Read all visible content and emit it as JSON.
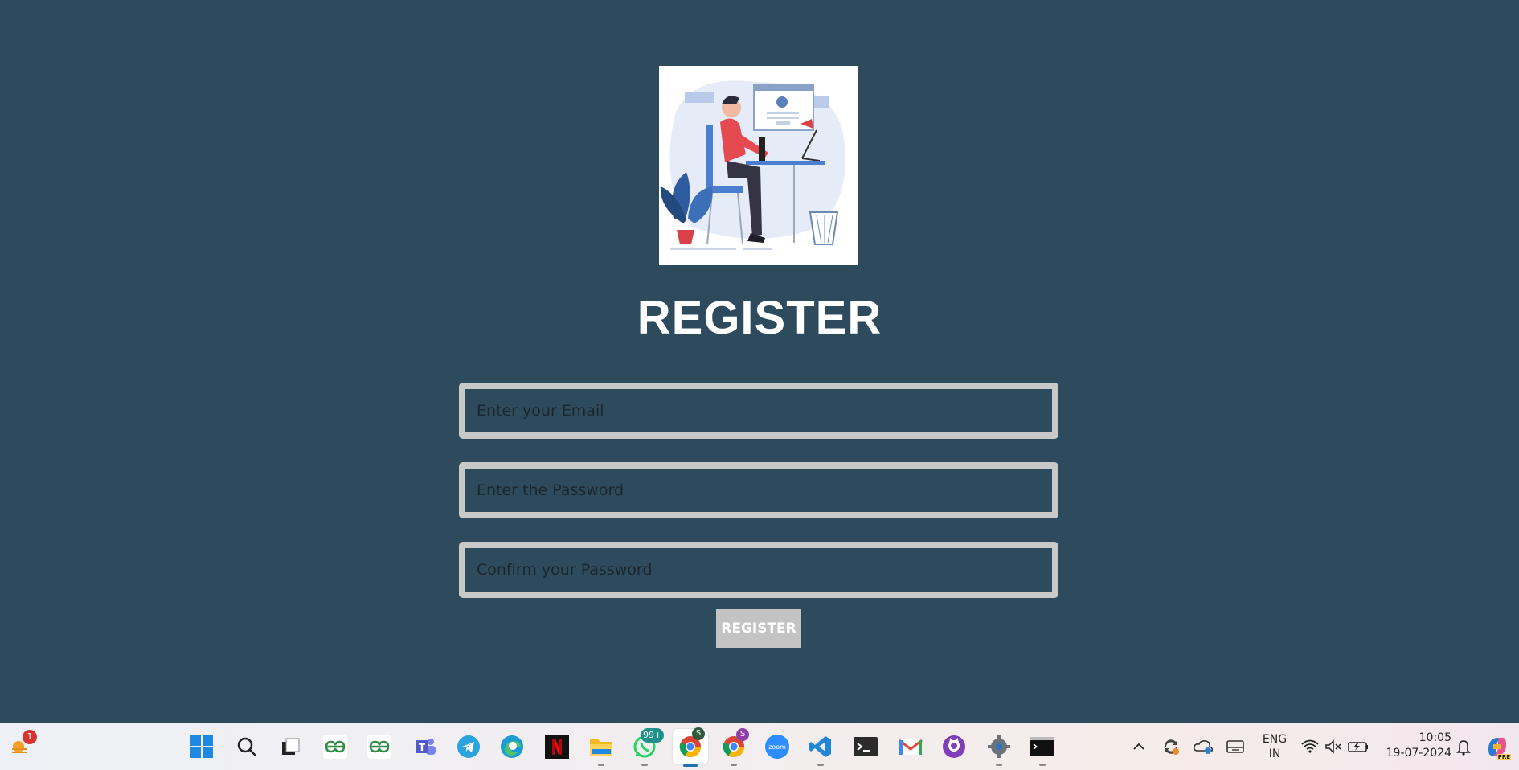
{
  "form": {
    "title": "REGISTER",
    "email_placeholder": "Enter your Email",
    "password_placeholder": "Enter the Password",
    "confirm_placeholder": "Confirm your Password",
    "submit_label": "REGISTER"
  },
  "taskbar": {
    "weather_badge": "1",
    "whatsapp_badge": "99+",
    "chrome_profile_1": "S",
    "chrome_profile_2": "S",
    "zoom_label": "zoom",
    "language_top": "ENG",
    "language_bottom": "IN",
    "time": "10:05",
    "date": "19-07-2024",
    "copilot_label": "PRE"
  },
  "colors": {
    "background": "#2d4b5d",
    "field_border": "#c9c9c9",
    "button": "#c3c3c3"
  }
}
